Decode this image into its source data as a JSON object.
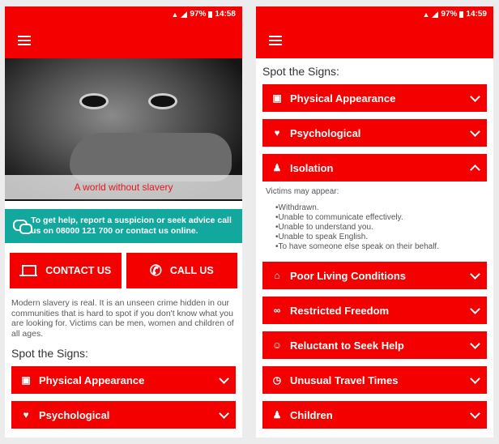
{
  "left_screen": {
    "status": {
      "signal_text": "97%",
      "time": "14:58"
    },
    "hero": {
      "tagline": "A world without slavery"
    },
    "help_banner": {
      "text": "To get help, report a suspicion or seek advice call us on 08000 121 700 or contact us online."
    },
    "buttons": {
      "contact": "CONTACT US",
      "call": "CALL US"
    },
    "intro": "Modern slavery is real. It is an unseen crime hidden in our communities that is hard to spot if you don't know what you are looking for. Victims can be men, women and children of all ages.",
    "section_title": "Spot the Signs:",
    "items": [
      {
        "label": "Physical Appearance",
        "icon": "camera-icon",
        "glyph": "▣"
      },
      {
        "label": "Psychological",
        "icon": "heart-icon",
        "glyph": "♥"
      }
    ]
  },
  "right_screen": {
    "status": {
      "signal_text": "97%",
      "time": "14:59"
    },
    "section_title": "Spot the Signs:",
    "items_top": [
      {
        "label": "Physical Appearance",
        "icon": "camera-icon",
        "glyph": "▣"
      },
      {
        "label": "Psychological",
        "icon": "heart-icon",
        "glyph": "♥"
      }
    ],
    "expanded_item": {
      "label": "Isolation",
      "icon": "person-icon",
      "glyph": "♟",
      "lead": "Victims may appear:",
      "bullets": [
        "Withdrawn.",
        "Unable to communicate effectively.",
        "Unable to understand you.",
        "Unable to speak English.",
        "To have someone else speak on their behalf."
      ]
    },
    "items_bottom": [
      {
        "label": "Poor Living Conditions",
        "icon": "home-icon",
        "glyph": "⌂"
      },
      {
        "label": "Restricted Freedom",
        "icon": "link-icon",
        "glyph": "∞"
      },
      {
        "label": "Reluctant to Seek Help",
        "icon": "group-icon",
        "glyph": "☺"
      },
      {
        "label": "Unusual Travel Times",
        "icon": "clock-icon",
        "glyph": "◷"
      },
      {
        "label": "Children",
        "icon": "child-icon",
        "glyph": "♟"
      }
    ]
  }
}
